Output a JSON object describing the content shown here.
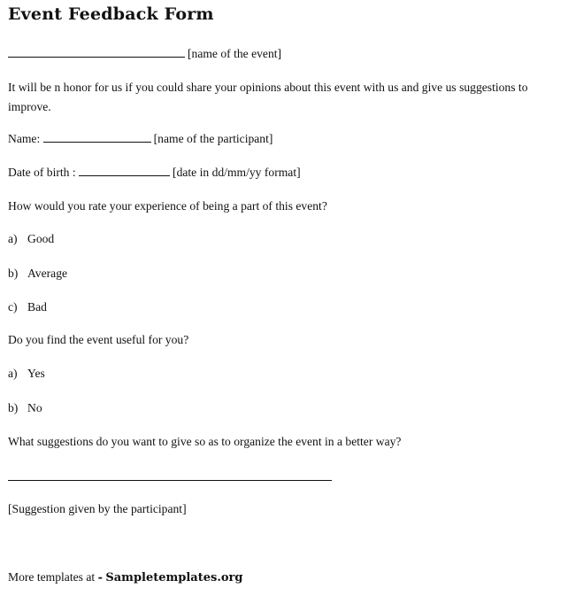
{
  "title": "Event Feedback Form",
  "event_name": {
    "hint": "[name of the event]"
  },
  "intro": "It will be n honor for us if you could share your opinions about this event with us and give us suggestions to improve.",
  "fields": {
    "name": {
      "label": "Name:",
      "hint": "[name of the participant]"
    },
    "dob": {
      "label": "Date of birth :",
      "hint": "[date in dd/mm/yy format]"
    }
  },
  "questions": [
    {
      "text": "How would you rate your experience of being a part of this event?",
      "options": [
        {
          "marker": "a)",
          "label": "Good"
        },
        {
          "marker": "b)",
          "label": "Average"
        },
        {
          "marker": "c)",
          "label": "Bad"
        }
      ]
    },
    {
      "text": "Do you find the event useful for you?",
      "options": [
        {
          "marker": "a)",
          "label": "Yes"
        },
        {
          "marker": "b)",
          "label": "No"
        }
      ]
    },
    {
      "text": "What suggestions do you want to give so as to organize the event in a better way?"
    }
  ],
  "suggestion_hint": "[Suggestion given by the participant]",
  "footer": {
    "prefix": "More templates at",
    "separator": "-",
    "link": "Sampletemplates.org"
  }
}
